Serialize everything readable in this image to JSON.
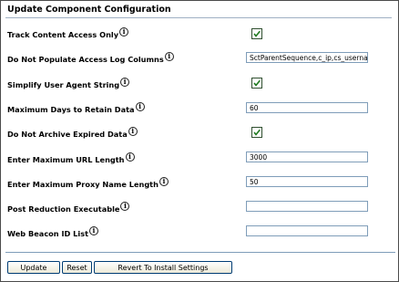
{
  "title": "Update Component Configuration",
  "settings": [
    {
      "label": "Track Content Access Only",
      "type": "checkbox",
      "checked": true
    },
    {
      "label": "Do Not Populate Access Log Columns",
      "type": "text",
      "value": "SctParentSequence,c_ip,cs_userna"
    },
    {
      "label": "Simplify User Agent String",
      "type": "checkbox",
      "checked": true
    },
    {
      "label": "Maximum Days to Retain Data",
      "type": "text",
      "value": "60"
    },
    {
      "label": "Do Not Archive Expired Data",
      "type": "checkbox",
      "checked": true
    },
    {
      "label": "Enter Maximum URL Length",
      "type": "text",
      "value": "3000"
    },
    {
      "label": "Enter Maximum Proxy Name Length",
      "type": "text",
      "value": "50"
    },
    {
      "label": "Post Reduction Executable",
      "type": "text",
      "value": ""
    },
    {
      "label": "Web Beacon ID List",
      "type": "text",
      "value": ""
    }
  ],
  "info_icon": {
    "glyph": "i",
    "icon": "info-icon"
  },
  "buttons": {
    "update": "Update",
    "reset": "Reset",
    "revert": "Revert To Install Settings"
  },
  "colors": {
    "title_rule": "#9fb0c4",
    "input_border": "#7f9db9",
    "checkmark": "#1f7a1f"
  }
}
